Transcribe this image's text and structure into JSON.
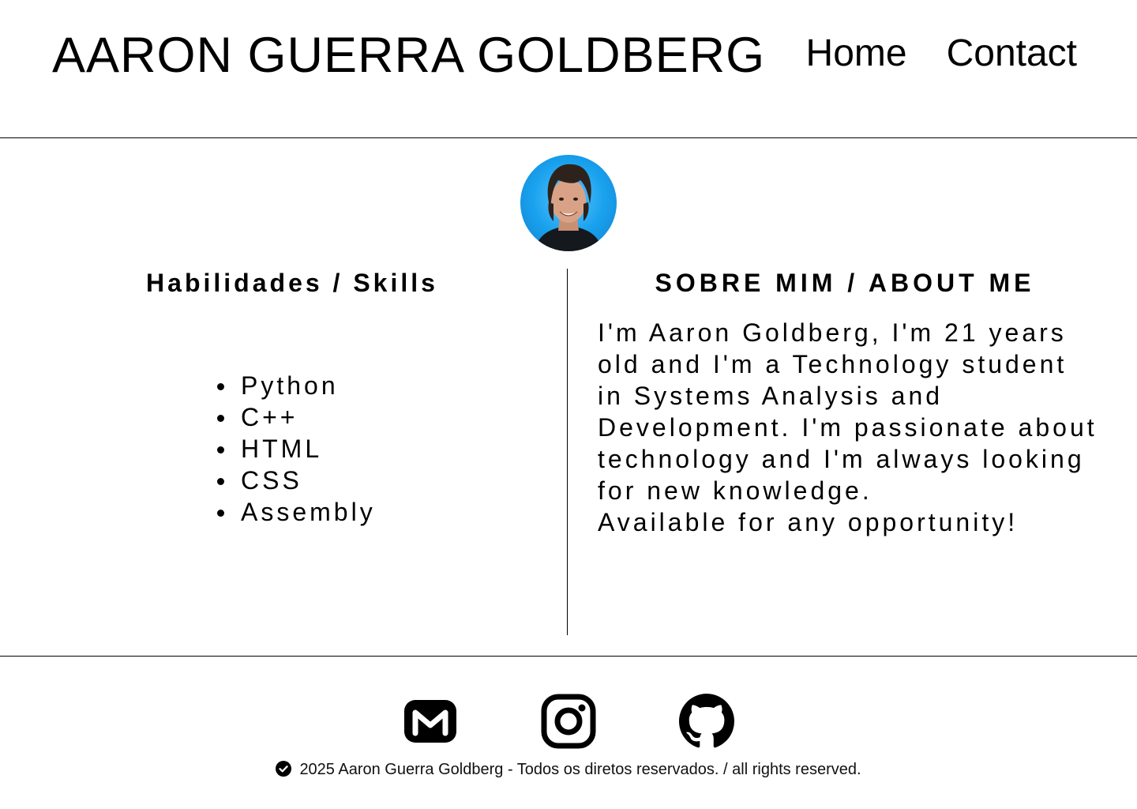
{
  "header": {
    "title": "AARON GUERRA GOLDBERG",
    "nav": [
      {
        "label": "Home"
      },
      {
        "label": "Contact"
      }
    ]
  },
  "skills": {
    "heading": "Habilidades / Skills",
    "items": [
      "Python",
      "C++",
      "HTML",
      "CSS",
      "Assembly"
    ]
  },
  "about": {
    "heading": "SOBRE MIM / ABOUT ME",
    "paragraph": "I'm Aaron Goldberg, I'm 21 years old and I'm a Technology student in Systems Analysis and Development. I'm passionate about technology and I'm always looking for new knowledge.",
    "closing": "Available for any opportunity!"
  },
  "social": [
    {
      "icon": "gmail-icon"
    },
    {
      "icon": "instagram-icon"
    },
    {
      "icon": "github-icon"
    }
  ],
  "footer": {
    "text": "2025 Aaron Guerra Goldberg - Todos os diretos reservados. / all rights reserved."
  },
  "colors": {
    "text": "#000000",
    "background": "#ffffff",
    "avatar_background": "#1aa2ee"
  }
}
